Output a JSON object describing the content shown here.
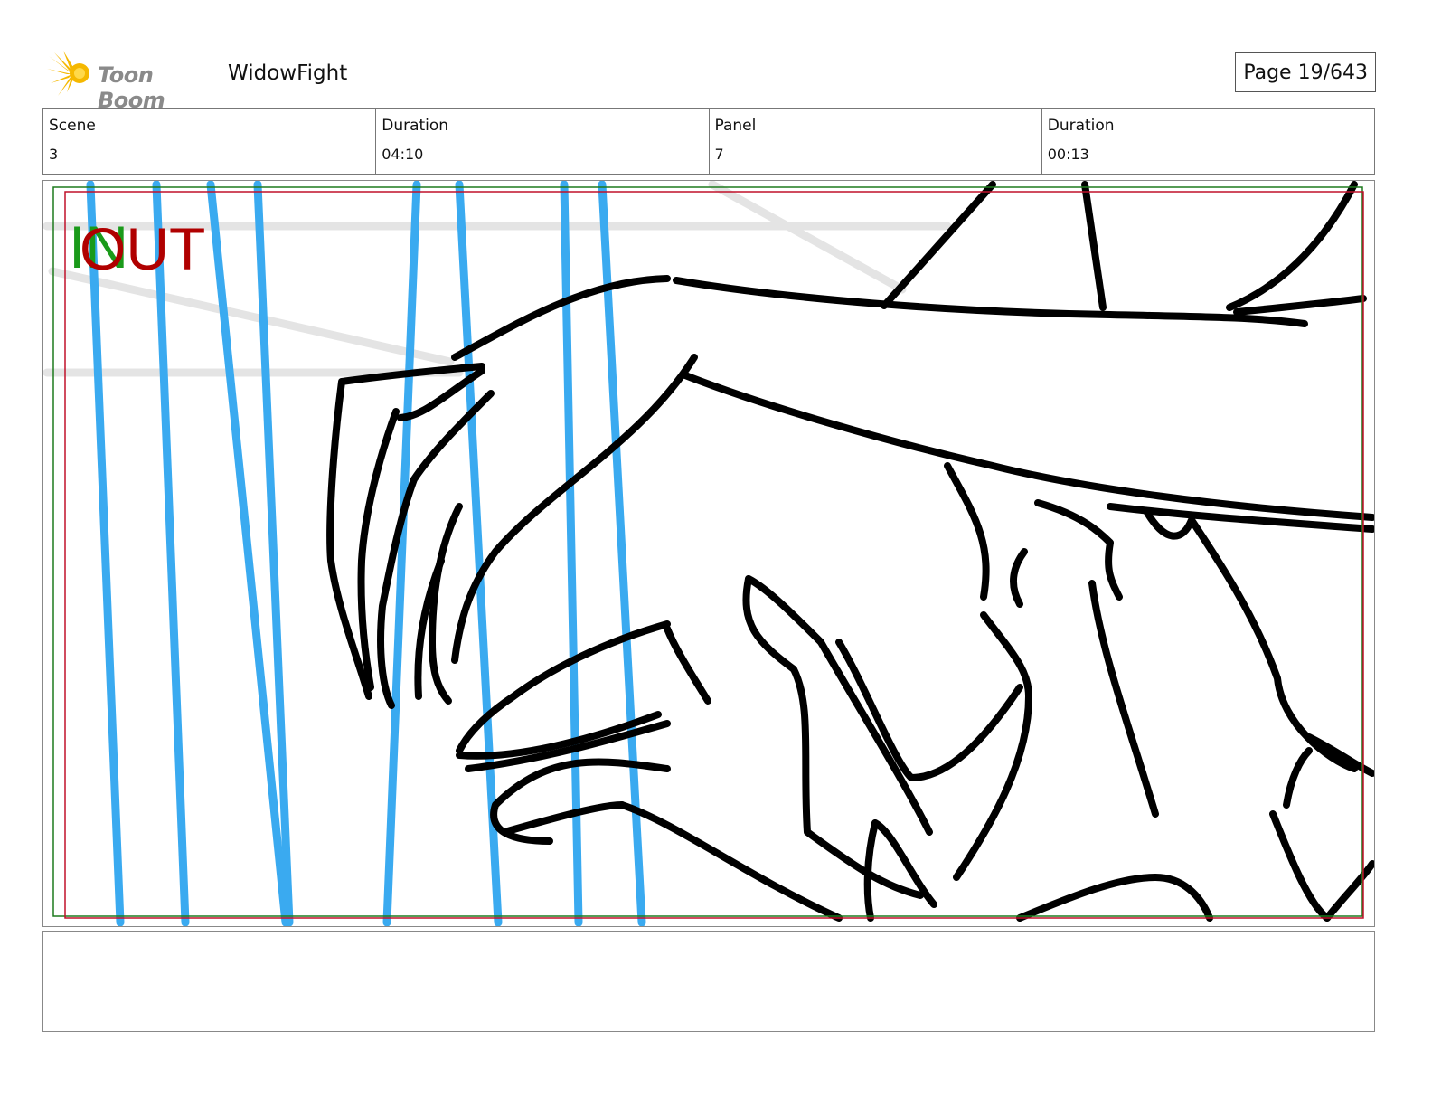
{
  "header": {
    "logo_text": "Toon Boom",
    "project_title": "WidowFight",
    "page_label": "Page",
    "page_number": "19/643"
  },
  "info": {
    "scene_label": "Scene",
    "scene_value": "3",
    "scene_duration_label": "Duration",
    "scene_duration_value": "04:10",
    "panel_label": "Panel",
    "panel_value": "7",
    "panel_duration_label": "Duration",
    "panel_duration_value": "00:13"
  },
  "panel": {
    "in_marker": "IN",
    "out_marker": "OUT",
    "colors": {
      "in_marker": "#1a9a1a",
      "out_marker": "#b00000",
      "safe_frame_green": "#1d7a1d",
      "safe_frame_red": "#c0102a",
      "blue_lines": "#3aaaf0",
      "sketch": "#000000"
    }
  },
  "notes": {
    "text": ""
  }
}
